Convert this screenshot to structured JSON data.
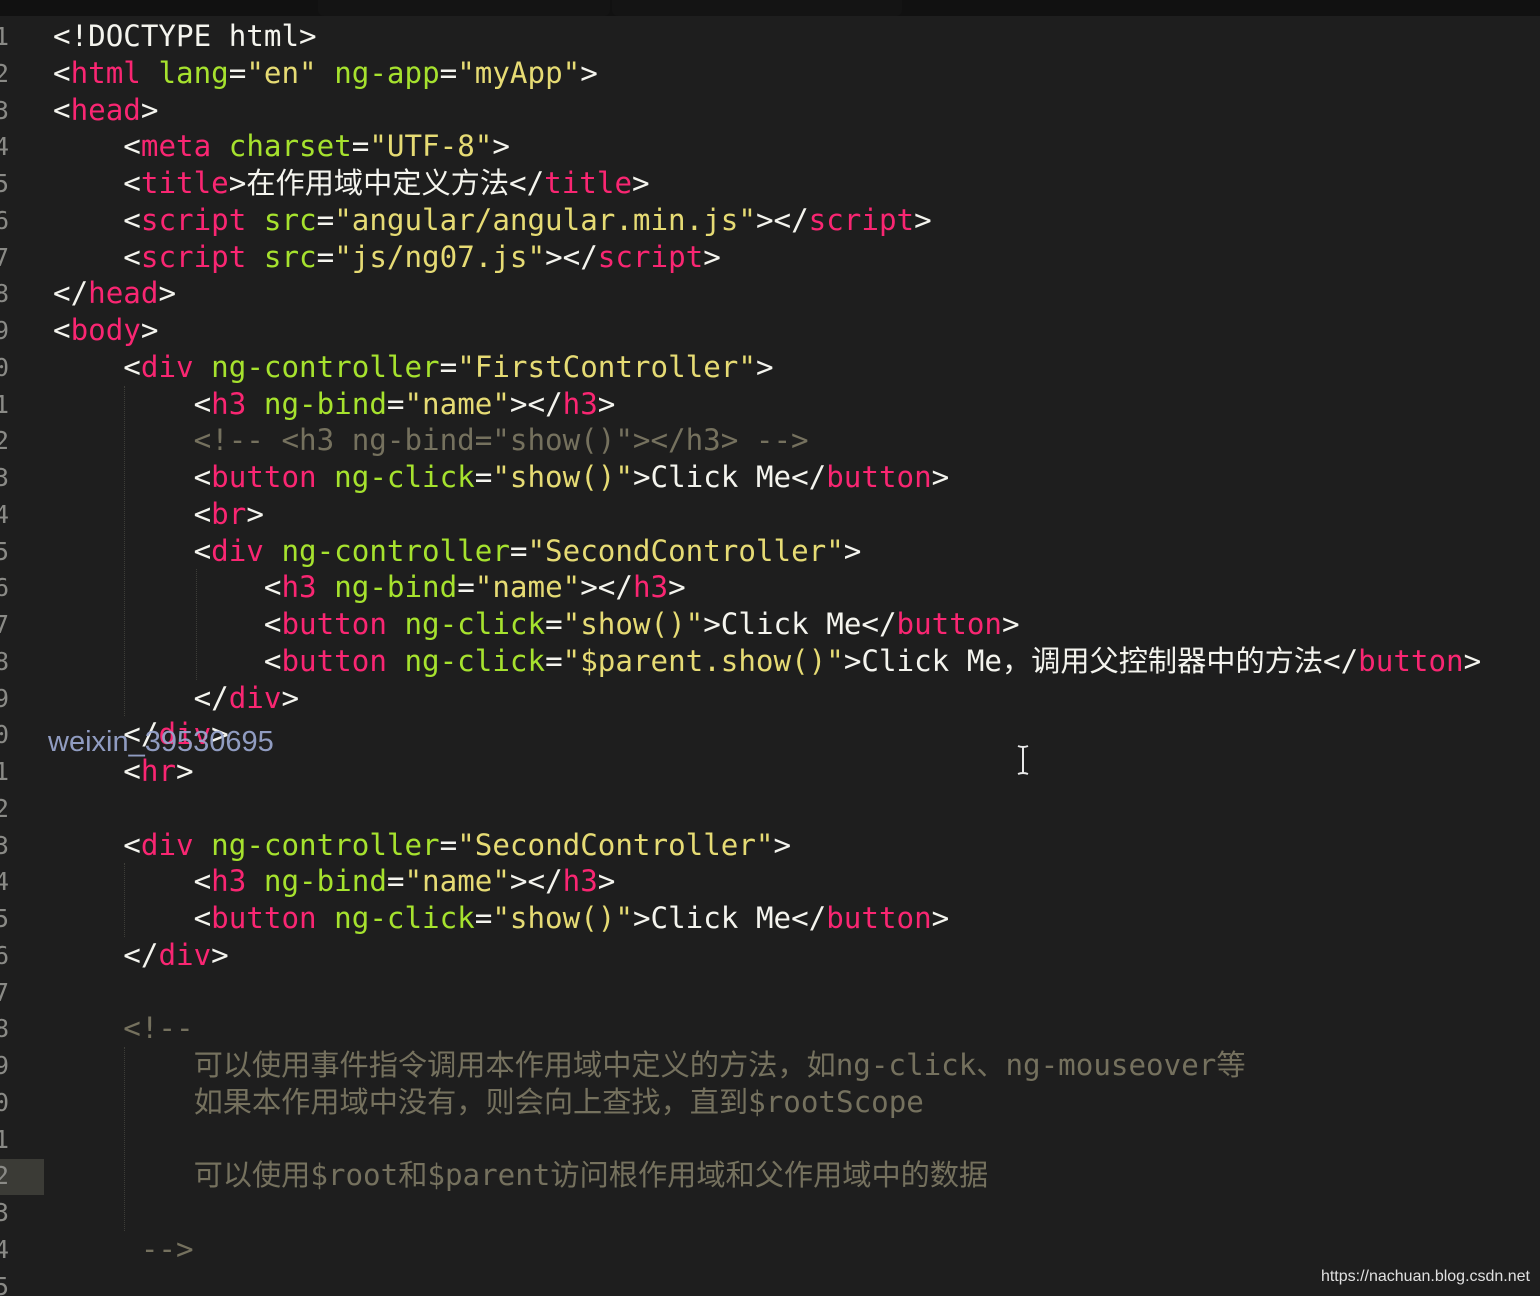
{
  "colors": {
    "background": "#1e1e1e",
    "tag": "#f92672",
    "attribute": "#a6e22e",
    "string": "#e6db74",
    "plain": "#f4f4ee",
    "comment": "#75715e",
    "line_number": "#8a8a86"
  },
  "gutter": {
    "line_numbers": [
      "1",
      "2",
      "3",
      "4",
      "5",
      "6",
      "7",
      "8",
      "9",
      "0",
      "1",
      "2",
      "3",
      "4",
      "5",
      "6",
      "7",
      "8",
      "9",
      "0",
      "1",
      "2",
      "3",
      "4",
      "5",
      "6",
      "7",
      "8",
      "9",
      "0",
      "1",
      "2",
      "3",
      "4",
      "5"
    ],
    "current_line_index": 31
  },
  "code": {
    "lines": [
      [
        [
          "p",
          "<!DOCTYPE html>"
        ]
      ],
      [
        [
          "p",
          "<"
        ],
        [
          "t",
          "html"
        ],
        [
          "p",
          " "
        ],
        [
          "a",
          "lang"
        ],
        [
          "p",
          "="
        ],
        [
          "s",
          "\"en\""
        ],
        [
          "p",
          " "
        ],
        [
          "a",
          "ng-app"
        ],
        [
          "p",
          "="
        ],
        [
          "s",
          "\"myApp\""
        ],
        [
          "p",
          ">"
        ]
      ],
      [
        [
          "p",
          "<"
        ],
        [
          "t",
          "head"
        ],
        [
          "p",
          ">"
        ]
      ],
      [
        [
          "p",
          "    <"
        ],
        [
          "t",
          "meta"
        ],
        [
          "p",
          " "
        ],
        [
          "a",
          "charset"
        ],
        [
          "p",
          "="
        ],
        [
          "s",
          "\"UTF-8\""
        ],
        [
          "p",
          ">"
        ]
      ],
      [
        [
          "p",
          "    <"
        ],
        [
          "t",
          "title"
        ],
        [
          "p",
          ">在作用域中定义方法</"
        ],
        [
          "t",
          "title"
        ],
        [
          "p",
          ">"
        ]
      ],
      [
        [
          "p",
          "    <"
        ],
        [
          "t",
          "script"
        ],
        [
          "p",
          " "
        ],
        [
          "a",
          "src"
        ],
        [
          "p",
          "="
        ],
        [
          "s",
          "\"angular/angular.min.js\""
        ],
        [
          "p",
          "></"
        ],
        [
          "t",
          "script"
        ],
        [
          "p",
          ">"
        ]
      ],
      [
        [
          "p",
          "    <"
        ],
        [
          "t",
          "script"
        ],
        [
          "p",
          " "
        ],
        [
          "a",
          "src"
        ],
        [
          "p",
          "="
        ],
        [
          "s",
          "\"js/ng07.js\""
        ],
        [
          "p",
          "></"
        ],
        [
          "t",
          "script"
        ],
        [
          "p",
          ">"
        ]
      ],
      [
        [
          "p",
          "</"
        ],
        [
          "t",
          "head"
        ],
        [
          "p",
          ">"
        ]
      ],
      [
        [
          "p",
          "<"
        ],
        [
          "t",
          "body"
        ],
        [
          "p",
          ">"
        ]
      ],
      [
        [
          "p",
          "    <"
        ],
        [
          "t",
          "div"
        ],
        [
          "p",
          " "
        ],
        [
          "a",
          "ng-controller"
        ],
        [
          "p",
          "="
        ],
        [
          "s",
          "\"FirstController\""
        ],
        [
          "p",
          ">"
        ]
      ],
      [
        [
          "p",
          "        <"
        ],
        [
          "t",
          "h3"
        ],
        [
          "p",
          " "
        ],
        [
          "a",
          "ng-bind"
        ],
        [
          "p",
          "="
        ],
        [
          "s",
          "\"name\""
        ],
        [
          "p",
          "></"
        ],
        [
          "t",
          "h3"
        ],
        [
          "p",
          ">"
        ]
      ],
      [
        [
          "c",
          "        <!-- <h3 ng-bind=\"show()\"></h3> -->"
        ]
      ],
      [
        [
          "p",
          "        <"
        ],
        [
          "t",
          "button"
        ],
        [
          "p",
          " "
        ],
        [
          "a",
          "ng-click"
        ],
        [
          "p",
          "="
        ],
        [
          "s",
          "\"show()\""
        ],
        [
          "p",
          ">Click Me</"
        ],
        [
          "t",
          "button"
        ],
        [
          "p",
          ">"
        ]
      ],
      [
        [
          "p",
          "        <"
        ],
        [
          "t",
          "br"
        ],
        [
          "p",
          ">"
        ]
      ],
      [
        [
          "p",
          "        <"
        ],
        [
          "t",
          "div"
        ],
        [
          "p",
          " "
        ],
        [
          "a",
          "ng-controller"
        ],
        [
          "p",
          "="
        ],
        [
          "s",
          "\"SecondController\""
        ],
        [
          "p",
          ">"
        ]
      ],
      [
        [
          "p",
          "            <"
        ],
        [
          "t",
          "h3"
        ],
        [
          "p",
          " "
        ],
        [
          "a",
          "ng-bind"
        ],
        [
          "p",
          "="
        ],
        [
          "s",
          "\"name\""
        ],
        [
          "p",
          "></"
        ],
        [
          "t",
          "h3"
        ],
        [
          "p",
          ">"
        ]
      ],
      [
        [
          "p",
          "            <"
        ],
        [
          "t",
          "button"
        ],
        [
          "p",
          " "
        ],
        [
          "a",
          "ng-click"
        ],
        [
          "p",
          "="
        ],
        [
          "s",
          "\"show()\""
        ],
        [
          "p",
          ">Click Me</"
        ],
        [
          "t",
          "button"
        ],
        [
          "p",
          ">"
        ]
      ],
      [
        [
          "p",
          "            <"
        ],
        [
          "t",
          "button"
        ],
        [
          "p",
          " "
        ],
        [
          "a",
          "ng-click"
        ],
        [
          "p",
          "="
        ],
        [
          "s",
          "\"$parent.show()\""
        ],
        [
          "p",
          ">Click Me，调用父控制器中的方法</"
        ],
        [
          "t",
          "button"
        ],
        [
          "p",
          ">"
        ]
      ],
      [
        [
          "p",
          "        </"
        ],
        [
          "t",
          "div"
        ],
        [
          "p",
          ">"
        ]
      ],
      [
        [
          "p",
          "    </"
        ],
        [
          "t",
          "div"
        ],
        [
          "p",
          ">"
        ]
      ],
      [
        [
          "p",
          "    <"
        ],
        [
          "t",
          "hr"
        ],
        [
          "p",
          ">"
        ]
      ],
      [],
      [
        [
          "p",
          "    <"
        ],
        [
          "t",
          "div"
        ],
        [
          "p",
          " "
        ],
        [
          "a",
          "ng-controller"
        ],
        [
          "p",
          "="
        ],
        [
          "s",
          "\"SecondController\""
        ],
        [
          "p",
          ">"
        ]
      ],
      [
        [
          "p",
          "        <"
        ],
        [
          "t",
          "h3"
        ],
        [
          "p",
          " "
        ],
        [
          "a",
          "ng-bind"
        ],
        [
          "p",
          "="
        ],
        [
          "s",
          "\"name\""
        ],
        [
          "p",
          "></"
        ],
        [
          "t",
          "h3"
        ],
        [
          "p",
          ">"
        ]
      ],
      [
        [
          "p",
          "        <"
        ],
        [
          "t",
          "button"
        ],
        [
          "p",
          " "
        ],
        [
          "a",
          "ng-click"
        ],
        [
          "p",
          "="
        ],
        [
          "s",
          "\"show()\""
        ],
        [
          "p",
          ">Click Me</"
        ],
        [
          "t",
          "button"
        ],
        [
          "p",
          ">"
        ]
      ],
      [
        [
          "p",
          "    </"
        ],
        [
          "t",
          "div"
        ],
        [
          "p",
          ">"
        ]
      ],
      [],
      [
        [
          "c",
          "    <!--"
        ]
      ],
      [
        [
          "c",
          "        可以使用事件指令调用本作用域中定义的方法，如ng-click、ng-mouseover等"
        ]
      ],
      [
        [
          "c",
          "        如果本作用域中没有，则会向上查找，直到$rootScope"
        ]
      ],
      [],
      [
        [
          "c",
          "        可以使用$root和$parent访问根作用域和父作用域中的数据"
        ]
      ],
      [],
      [
        [
          "c",
          "     -->"
        ]
      ],
      []
    ]
  },
  "watermark": {
    "user": "weixin_39530695",
    "url": "https://nachuan.blog.csdn.net"
  }
}
